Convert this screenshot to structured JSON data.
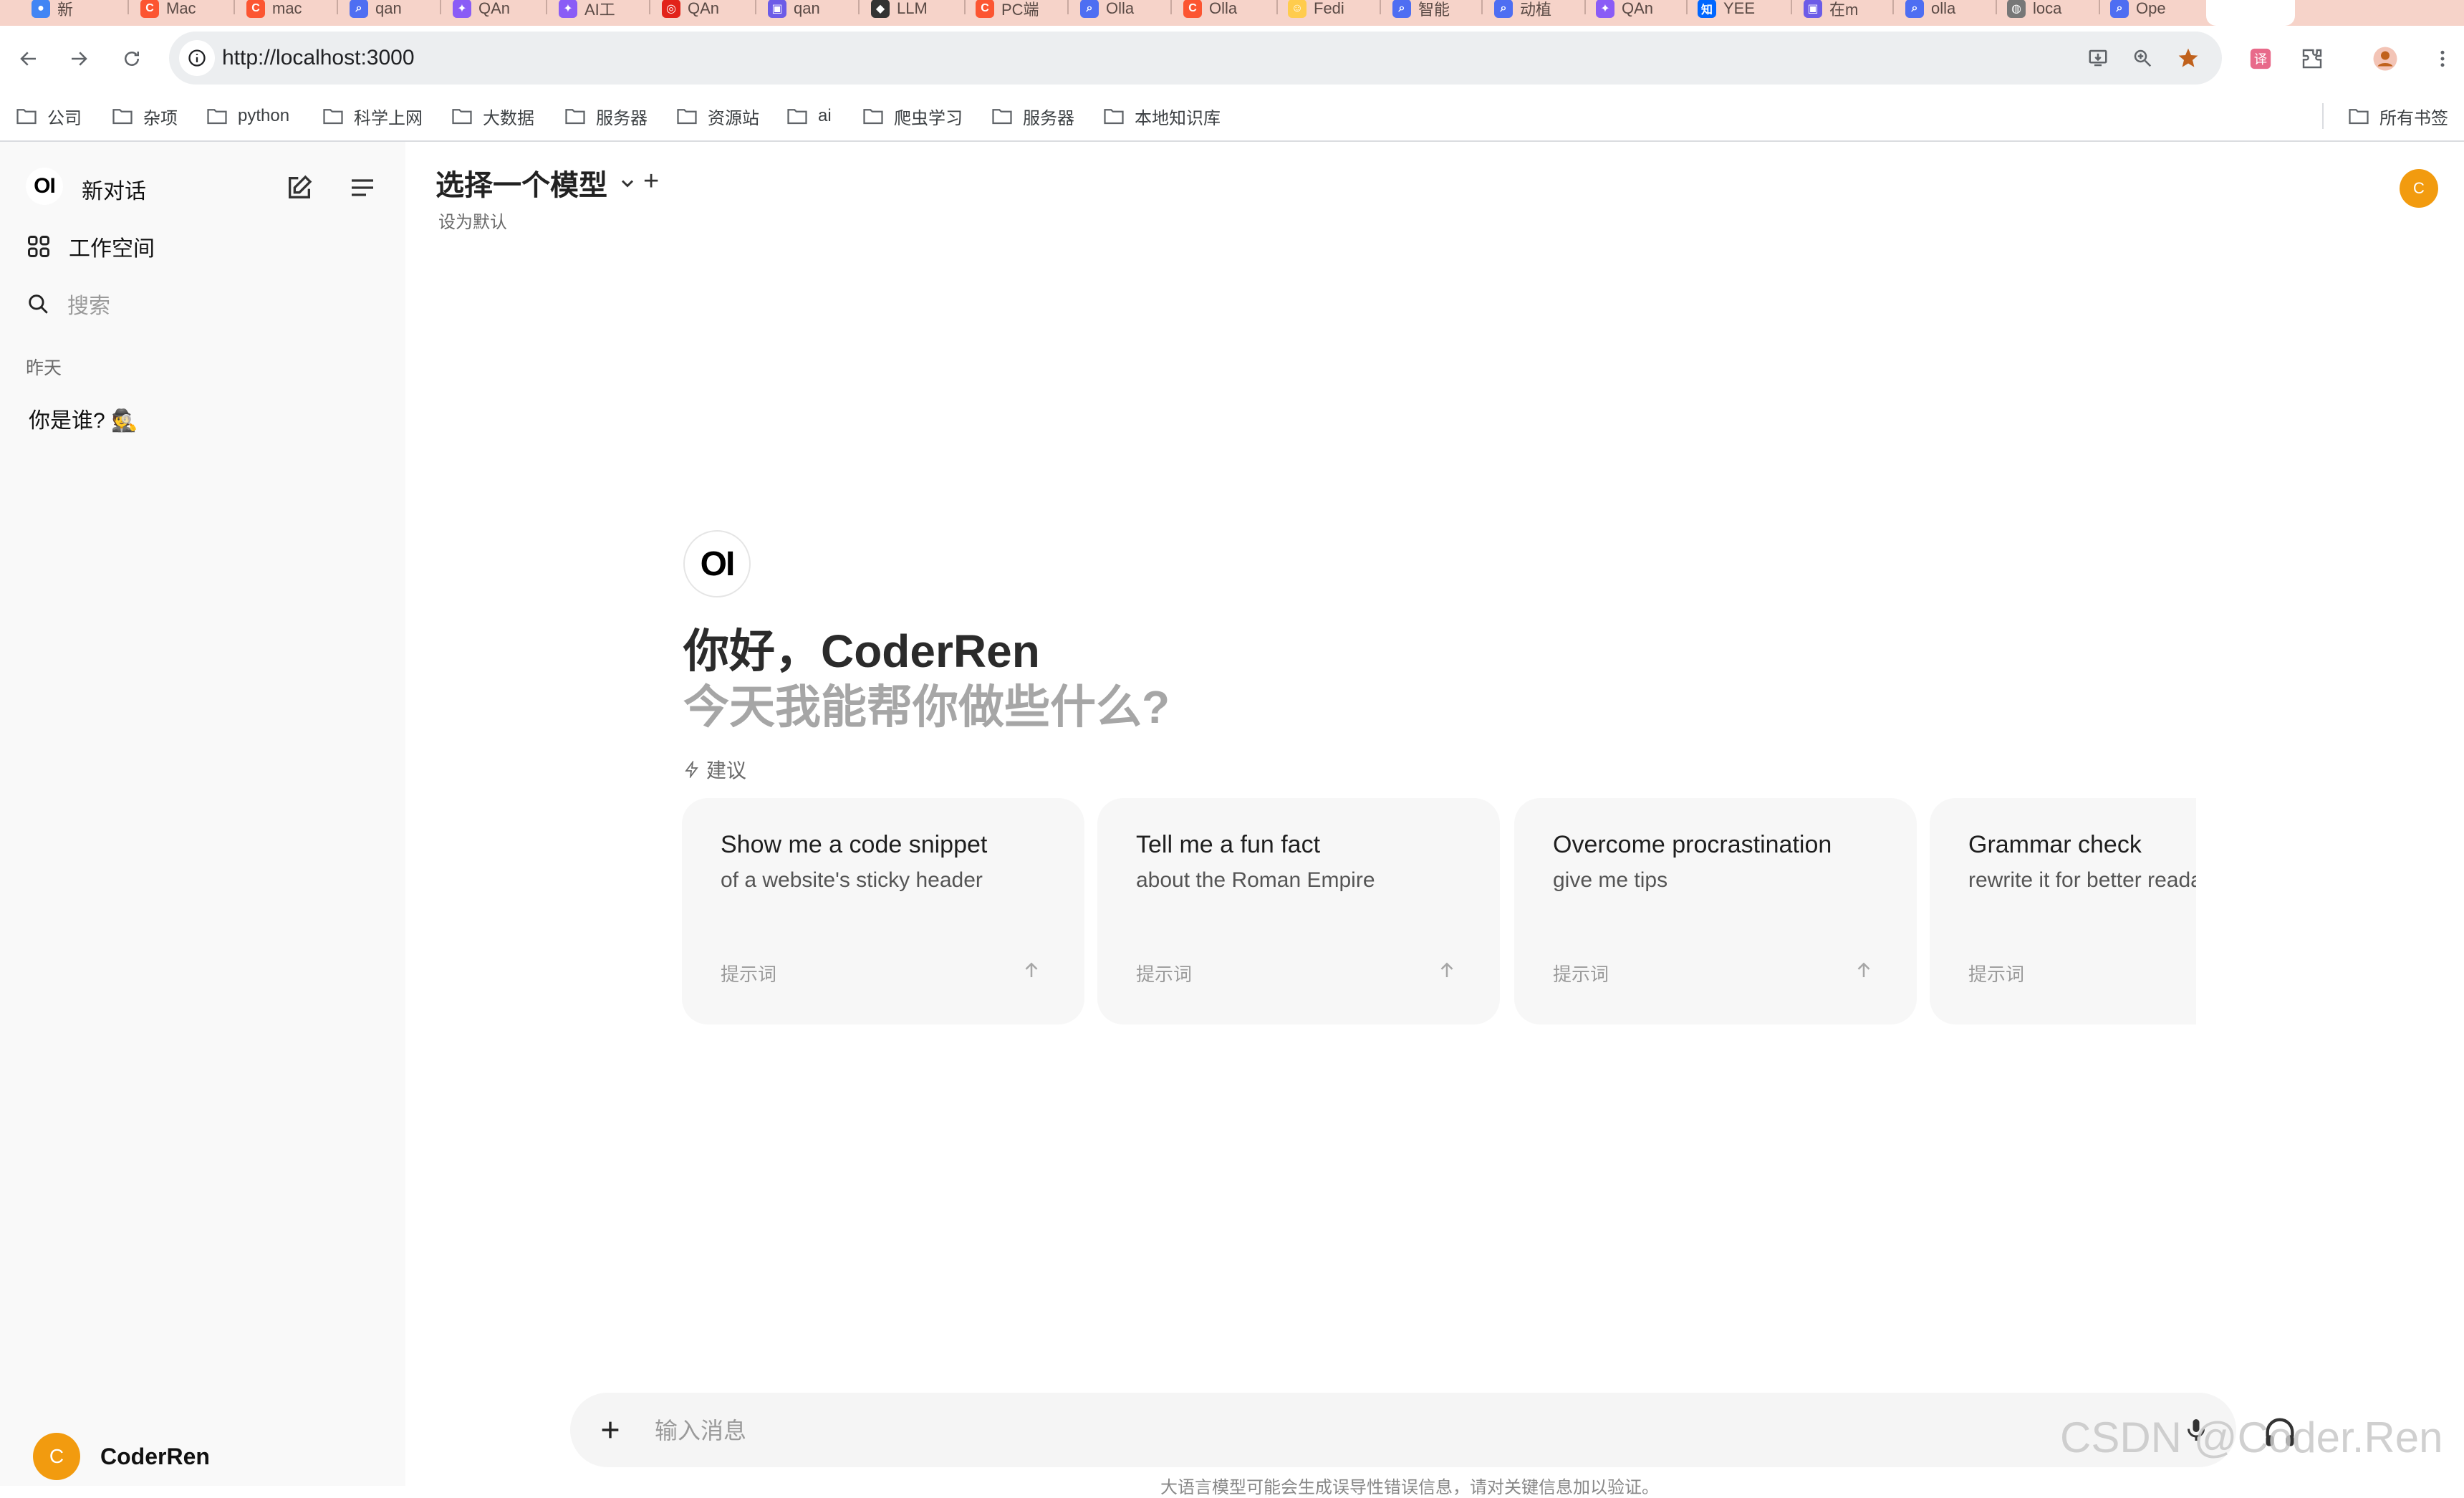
{
  "browser": {
    "tabs": [
      {
        "label": "新",
        "icon": "chrome-icon",
        "color": "#4285f4"
      },
      {
        "label": "Mac",
        "icon": "csdn-icon",
        "color": "#fc5531"
      },
      {
        "label": "mac",
        "icon": "csdn-icon",
        "color": "#fc5531"
      },
      {
        "label": "qan",
        "icon": "search-icon",
        "color": "#4e6ef2"
      },
      {
        "label": "QAn",
        "icon": "ai-icon",
        "color": "#8a5cf6"
      },
      {
        "label": "AI工",
        "icon": "ai-icon",
        "color": "#8a5cf6"
      },
      {
        "label": "QAn",
        "icon": "target-icon",
        "color": "#e2231a"
      },
      {
        "label": "qan",
        "icon": "doc-icon",
        "color": "#6c5ce7"
      },
      {
        "label": "LLM",
        "icon": "github-icon",
        "color": "#333333"
      },
      {
        "label": "PC端",
        "icon": "csdn-icon",
        "color": "#fc5531"
      },
      {
        "label": "Olla",
        "icon": "search-icon",
        "color": "#4e6ef2"
      },
      {
        "label": "Olla",
        "icon": "csdn-icon",
        "color": "#fc5531"
      },
      {
        "label": "Fedi",
        "icon": "huggingface-icon",
        "color": "#ffcc4d"
      },
      {
        "label": "智能",
        "icon": "search-icon",
        "color": "#4e6ef2"
      },
      {
        "label": "动植",
        "icon": "search-icon",
        "color": "#4e6ef2"
      },
      {
        "label": "QAn",
        "icon": "ai-icon",
        "color": "#8a5cf6"
      },
      {
        "label": "YEE",
        "icon": "zhihu-icon",
        "color": "#0066ff"
      },
      {
        "label": "在m",
        "icon": "doc-icon",
        "color": "#6c5ce7"
      },
      {
        "label": "olla",
        "icon": "search-icon",
        "color": "#4e6ef2"
      },
      {
        "label": "loca",
        "icon": "globe-icon",
        "color": "#777777"
      },
      {
        "label": "Ope",
        "icon": "search-icon",
        "color": "#4e6ef2"
      }
    ],
    "url": "http://localhost:3000"
  },
  "bookmarks": [
    {
      "label": "公司"
    },
    {
      "label": "杂项"
    },
    {
      "label": "python"
    },
    {
      "label": "科学上网"
    },
    {
      "label": "大数据"
    },
    {
      "label": "服务器"
    },
    {
      "label": "资源站"
    },
    {
      "label": "ai"
    },
    {
      "label": "爬虫学习"
    },
    {
      "label": "服务器"
    },
    {
      "label": "本地知识库"
    }
  ],
  "bookmarks_all": "所有书签",
  "sidebar": {
    "logo": "OI",
    "new_chat": "新对话",
    "workspace": "工作空间",
    "search_placeholder": "搜索",
    "section_yesterday": "昨天",
    "chats": [
      "你是谁? 🕵"
    ],
    "user_initial": "C",
    "username": "CoderRen"
  },
  "header": {
    "model_select": "选择一个模型",
    "add": "+",
    "set_default": "设为默认",
    "avatar_initial": "C"
  },
  "welcome": {
    "logo": "OI",
    "greeting": "你好，CoderRen",
    "subtitle": "今天我能帮你做些什么?",
    "suggest_label": "建议"
  },
  "suggestions": [
    {
      "title": "Show me a code snippet",
      "subtitle": "of a website's sticky header",
      "tag": "提示词"
    },
    {
      "title": "Tell me a fun fact",
      "subtitle": "about the Roman Empire",
      "tag": "提示词"
    },
    {
      "title": "Overcome procrastination",
      "subtitle": "give me tips",
      "tag": "提示词"
    },
    {
      "title": "Grammar check",
      "subtitle": "rewrite it for better readability",
      "tag": "提示词"
    }
  ],
  "composer": {
    "placeholder": "输入消息",
    "disclaimer": "大语言模型可能会生成误导性错误信息，请对关键信息加以验证。"
  },
  "watermark": "CSDN @Coder.Ren",
  "colors": {
    "accent_avatar": "#f29b0f",
    "tabstrip": "#f6d3c9",
    "sidebar_bg": "#f9f9f9",
    "card_bg": "#f7f7f7",
    "bookmark_star": "#c0611c"
  }
}
